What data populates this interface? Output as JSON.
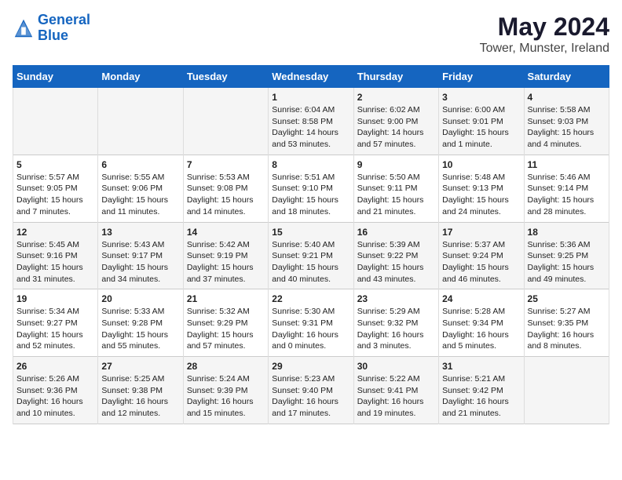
{
  "logo": {
    "line1": "General",
    "line2": "Blue"
  },
  "title": "May 2024",
  "subtitle": "Tower, Munster, Ireland",
  "days_of_week": [
    "Sunday",
    "Monday",
    "Tuesday",
    "Wednesday",
    "Thursday",
    "Friday",
    "Saturday"
  ],
  "weeks": [
    [
      {
        "day": "",
        "info": ""
      },
      {
        "day": "",
        "info": ""
      },
      {
        "day": "",
        "info": ""
      },
      {
        "day": "1",
        "info": "Sunrise: 6:04 AM\nSunset: 8:58 PM\nDaylight: 14 hours\nand 53 minutes."
      },
      {
        "day": "2",
        "info": "Sunrise: 6:02 AM\nSunset: 9:00 PM\nDaylight: 14 hours\nand 57 minutes."
      },
      {
        "day": "3",
        "info": "Sunrise: 6:00 AM\nSunset: 9:01 PM\nDaylight: 15 hours\nand 1 minute."
      },
      {
        "day": "4",
        "info": "Sunrise: 5:58 AM\nSunset: 9:03 PM\nDaylight: 15 hours\nand 4 minutes."
      }
    ],
    [
      {
        "day": "5",
        "info": "Sunrise: 5:57 AM\nSunset: 9:05 PM\nDaylight: 15 hours\nand 7 minutes."
      },
      {
        "day": "6",
        "info": "Sunrise: 5:55 AM\nSunset: 9:06 PM\nDaylight: 15 hours\nand 11 minutes."
      },
      {
        "day": "7",
        "info": "Sunrise: 5:53 AM\nSunset: 9:08 PM\nDaylight: 15 hours\nand 14 minutes."
      },
      {
        "day": "8",
        "info": "Sunrise: 5:51 AM\nSunset: 9:10 PM\nDaylight: 15 hours\nand 18 minutes."
      },
      {
        "day": "9",
        "info": "Sunrise: 5:50 AM\nSunset: 9:11 PM\nDaylight: 15 hours\nand 21 minutes."
      },
      {
        "day": "10",
        "info": "Sunrise: 5:48 AM\nSunset: 9:13 PM\nDaylight: 15 hours\nand 24 minutes."
      },
      {
        "day": "11",
        "info": "Sunrise: 5:46 AM\nSunset: 9:14 PM\nDaylight: 15 hours\nand 28 minutes."
      }
    ],
    [
      {
        "day": "12",
        "info": "Sunrise: 5:45 AM\nSunset: 9:16 PM\nDaylight: 15 hours\nand 31 minutes."
      },
      {
        "day": "13",
        "info": "Sunrise: 5:43 AM\nSunset: 9:17 PM\nDaylight: 15 hours\nand 34 minutes."
      },
      {
        "day": "14",
        "info": "Sunrise: 5:42 AM\nSunset: 9:19 PM\nDaylight: 15 hours\nand 37 minutes."
      },
      {
        "day": "15",
        "info": "Sunrise: 5:40 AM\nSunset: 9:21 PM\nDaylight: 15 hours\nand 40 minutes."
      },
      {
        "day": "16",
        "info": "Sunrise: 5:39 AM\nSunset: 9:22 PM\nDaylight: 15 hours\nand 43 minutes."
      },
      {
        "day": "17",
        "info": "Sunrise: 5:37 AM\nSunset: 9:24 PM\nDaylight: 15 hours\nand 46 minutes."
      },
      {
        "day": "18",
        "info": "Sunrise: 5:36 AM\nSunset: 9:25 PM\nDaylight: 15 hours\nand 49 minutes."
      }
    ],
    [
      {
        "day": "19",
        "info": "Sunrise: 5:34 AM\nSunset: 9:27 PM\nDaylight: 15 hours\nand 52 minutes."
      },
      {
        "day": "20",
        "info": "Sunrise: 5:33 AM\nSunset: 9:28 PM\nDaylight: 15 hours\nand 55 minutes."
      },
      {
        "day": "21",
        "info": "Sunrise: 5:32 AM\nSunset: 9:29 PM\nDaylight: 15 hours\nand 57 minutes."
      },
      {
        "day": "22",
        "info": "Sunrise: 5:30 AM\nSunset: 9:31 PM\nDaylight: 16 hours\nand 0 minutes."
      },
      {
        "day": "23",
        "info": "Sunrise: 5:29 AM\nSunset: 9:32 PM\nDaylight: 16 hours\nand 3 minutes."
      },
      {
        "day": "24",
        "info": "Sunrise: 5:28 AM\nSunset: 9:34 PM\nDaylight: 16 hours\nand 5 minutes."
      },
      {
        "day": "25",
        "info": "Sunrise: 5:27 AM\nSunset: 9:35 PM\nDaylight: 16 hours\nand 8 minutes."
      }
    ],
    [
      {
        "day": "26",
        "info": "Sunrise: 5:26 AM\nSunset: 9:36 PM\nDaylight: 16 hours\nand 10 minutes."
      },
      {
        "day": "27",
        "info": "Sunrise: 5:25 AM\nSunset: 9:38 PM\nDaylight: 16 hours\nand 12 minutes."
      },
      {
        "day": "28",
        "info": "Sunrise: 5:24 AM\nSunset: 9:39 PM\nDaylight: 16 hours\nand 15 minutes."
      },
      {
        "day": "29",
        "info": "Sunrise: 5:23 AM\nSunset: 9:40 PM\nDaylight: 16 hours\nand 17 minutes."
      },
      {
        "day": "30",
        "info": "Sunrise: 5:22 AM\nSunset: 9:41 PM\nDaylight: 16 hours\nand 19 minutes."
      },
      {
        "day": "31",
        "info": "Sunrise: 5:21 AM\nSunset: 9:42 PM\nDaylight: 16 hours\nand 21 minutes."
      },
      {
        "day": "",
        "info": ""
      }
    ]
  ]
}
